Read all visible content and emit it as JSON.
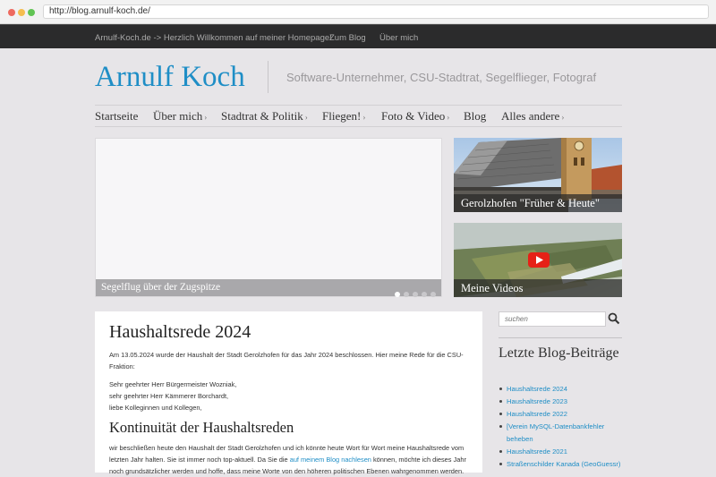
{
  "browser": {
    "url": "http://blog.arnulf-koch.de/"
  },
  "topnav": {
    "items": [
      "Arnulf-Koch.de -> Herzlich Willkommen auf meiner Homepage!",
      "Zum Blog",
      "Über mich"
    ]
  },
  "header": {
    "site_title": "Arnulf Koch",
    "tagline": "Software-Unternehmer, CSU-Stadtrat, Segelflieger, Fotograf"
  },
  "menu": {
    "items": [
      {
        "label": "Startseite",
        "chevron": ""
      },
      {
        "label": "Über mich",
        "chevron": "›"
      },
      {
        "label": "Stadtrat & Politik",
        "chevron": "›"
      },
      {
        "label": "Fliegen!",
        "chevron": "›"
      },
      {
        "label": "Foto & Video",
        "chevron": "›"
      },
      {
        "label": "Blog",
        "chevron": ""
      },
      {
        "label": "Alles andere",
        "chevron": "›"
      }
    ]
  },
  "slider": {
    "caption": "Segelflug über der Zugspitze",
    "slide_count": 5,
    "active_slide": 1
  },
  "features": [
    {
      "caption": "Gerolzhofen \"Früher & Heute\"",
      "icon": "church-photo"
    },
    {
      "caption": "Meine Videos",
      "icon": "youtube-play-icon"
    }
  ],
  "post": {
    "title": "Haushaltsrede 2024",
    "intro": "Am 13.05.2024 wurde der Haushalt der Stadt Gerolzhofen für das Jahr 2024 beschlossen. Hier meine Rede für die CSU-Fraktion:",
    "salutation_1": "Sehr geehrter Herr Bürgermeister Wozniak,",
    "salutation_2": "sehr geehrter Herr Kämmerer Borchardt,",
    "salutation_3": "liebe Kolleginnen und Kollegen,",
    "subtitle": "Kontinuität der Haushaltsreden",
    "body_1": "wir beschließen heute den Haushalt der Stadt Gerolzhofen und ich könnte heute Wort für Wort meine Haushaltsrede vom",
    "body_2_a": "letzten Jahr halten. Sie ist immer noch top-aktuell. Da Sie die ",
    "body_2_link": "auf meinem Blog nachlesen",
    "body_2_b": " können, möchte ich dieses Jahr",
    "body_3": "noch grundsätzlicher werden und hoffe, dass meine Worte von den höheren politischen Ebenen wahrgenommen werden."
  },
  "sidebar": {
    "search_placeholder": "suchen",
    "heading": "Letzte Blog-Beiträge",
    "recent_posts": [
      "Haushaltsrede 2024",
      "Haushaltsrede 2023",
      "Haushaltsrede 2022",
      "[Verein MySQL-Datenbankfehler beheben",
      "Haushaltsrede 2021",
      "Straßenschilder Kanada (GeoGuessr)"
    ]
  },
  "colors": {
    "accent": "#1f8ec6",
    "topbar": "#2b2b2c",
    "page_bg": "#e7e5e8"
  }
}
